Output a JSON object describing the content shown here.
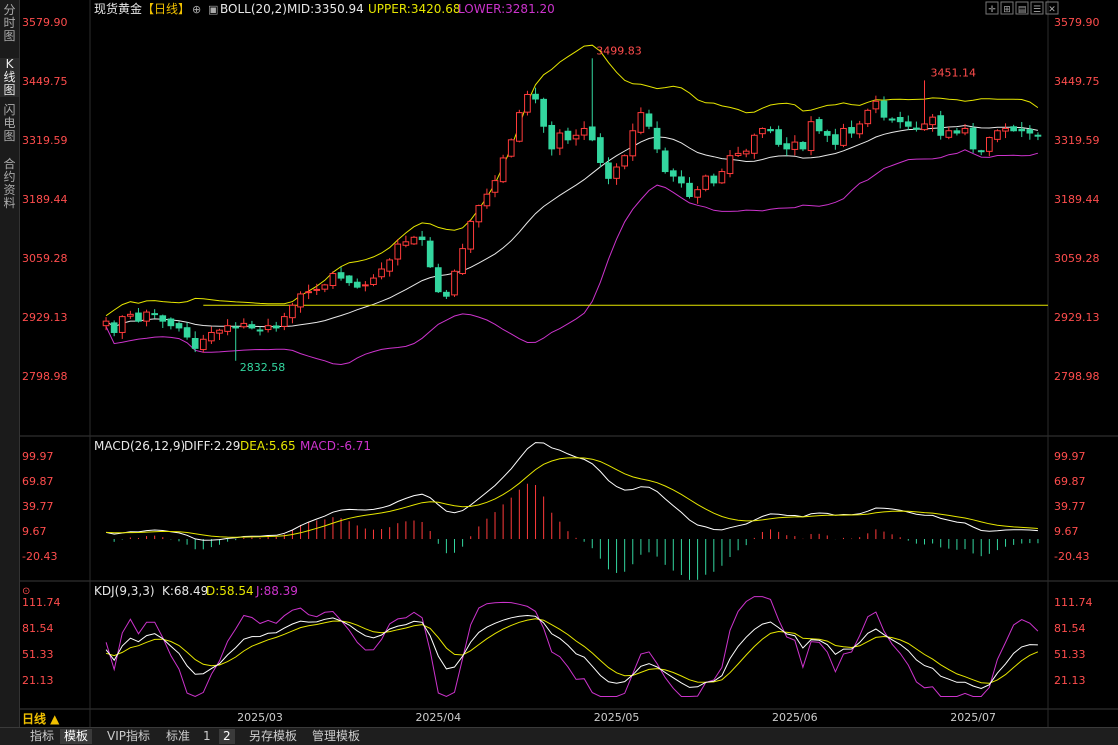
{
  "side_tabs": [
    "分时图",
    "K线图",
    "闪电图",
    "合约资料"
  ],
  "header": {
    "symbol": "现货黄金",
    "period_tag": "【日线】",
    "boll_label": "BOLL(20,2)",
    "mid": "MID:3350.94",
    "upper": "UPPER:3420.68",
    "lower": "LOWER:3281.20"
  },
  "macd_header": {
    "name": "MACD(26,12,9)",
    "diff": "DIFF:2.29",
    "dea": "DEA:5.65",
    "macd": "MACD:-6.71"
  },
  "kdj_header": {
    "name": "KDJ(9,3,3)",
    "k": "K:68.49",
    "d": "D:58.54",
    "j": "J:88.39"
  },
  "period_selector": "日线 ▲",
  "bottom_tabs": [
    "指标",
    "模板",
    "VIP指标",
    "标准",
    "1",
    "2",
    "另存模板",
    "管理模板"
  ],
  "bottom_active": [
    1,
    5
  ],
  "window_icons": [
    "crosshair-icon",
    "zoom-icon",
    "layout-icon",
    "list-icon",
    "close-icon"
  ],
  "colors": {
    "up": "#ff3b3b",
    "down": "#33d69f",
    "mid": "#e8e8e8",
    "upper": "#e6e600",
    "lower": "#cc33cc",
    "k": "#ffffff",
    "d": "#e6e600",
    "j": "#cc33cc",
    "axis_text": "#ff4d4d",
    "label_high": "#ff4d4d",
    "label_low": "#33d69f"
  },
  "chart_data": [
    {
      "type": "candlestick",
      "title": "现货黄金【日线】",
      "y_ticks": [
        "3579.90",
        "3449.75",
        "3319.59",
        "3189.44",
        "3059.28",
        "2929.13",
        "2798.98"
      ],
      "ylim": [
        2750,
        3600
      ],
      "x_ticks": [
        "2025/03",
        "2025/04",
        "2025/05",
        "2025/06",
        "2025/07"
      ],
      "annotations": [
        {
          "text": "3499.83"
        },
        {
          "text": "3451.14"
        },
        {
          "text": "2832.58"
        }
      ],
      "horizontal_line": 2955,
      "close": [
        2920,
        2895,
        2930,
        2935,
        2920,
        2940,
        2935,
        2920,
        2910,
        2905,
        2885,
        2860,
        2880,
        2895,
        2900,
        2910,
        2905,
        2915,
        2905,
        2900,
        2910,
        2905,
        2930,
        2955,
        2980,
        2985,
        2990,
        3000,
        3025,
        3015,
        3005,
        2995,
        3000,
        3015,
        3035,
        3055,
        3090,
        3095,
        3105,
        3100,
        3040,
        2985,
        2975,
        3030,
        3080,
        3140,
        3175,
        3200,
        3230,
        3280,
        3320,
        3380,
        3420,
        3410,
        3350,
        3300,
        3335,
        3320,
        3330,
        3345,
        3320,
        3270,
        3235,
        3260,
        3285,
        3340,
        3380,
        3350,
        3300,
        3250,
        3240,
        3225,
        3195,
        3210,
        3240,
        3225,
        3250,
        3285,
        3290,
        3295,
        3330,
        3345,
        3340,
        3310,
        3300,
        3315,
        3300,
        3360,
        3340,
        3330,
        3310,
        3345,
        3335,
        3355,
        3385,
        3405,
        3370,
        3365,
        3360,
        3350,
        3345,
        3355,
        3370,
        3330,
        3340,
        3335,
        3345,
        3300,
        3295,
        3325,
        3340,
        3345,
        3340,
        3340,
        3335,
        3330
      ]
    },
    {
      "type": "macd",
      "y_ticks": [
        "99.97",
        "69.87",
        "39.77",
        "9.67",
        "-20.43"
      ],
      "ylim": [
        -35,
        108
      ]
    },
    {
      "type": "kdj",
      "y_ticks": [
        "111.74",
        "81.54",
        "51.33",
        "21.13"
      ],
      "ylim": [
        0,
        120
      ]
    }
  ]
}
